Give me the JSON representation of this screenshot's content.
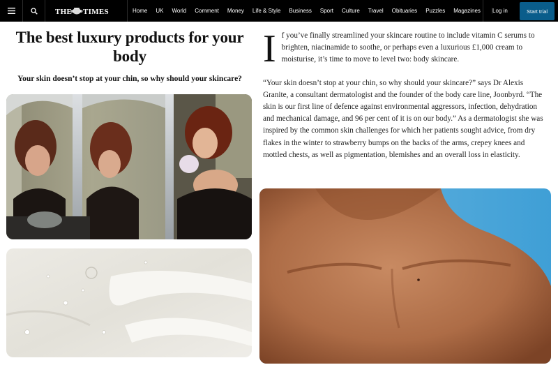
{
  "nav": {
    "menu_icon": "hamburger-menu-icon",
    "search_icon": "search-icon",
    "logo_text": "THE TIMES",
    "links": [
      "Home",
      "UK",
      "World",
      "Comment",
      "Money",
      "Life & Style",
      "Business",
      "Sport",
      "Culture",
      "Travel",
      "Obituaries",
      "Puzzles",
      "Magazines"
    ],
    "login": "Log in",
    "start_trial": "Start trial",
    "accent_color": "#0a5d8b"
  },
  "article": {
    "headline": "The best luxury products for your body",
    "standfirst": "Your skin doesn’t stop at your chin, so why should your skincare?",
    "dropcap": "I",
    "para1": "f you’ve finally streamlined your skincare routine to include vitamin C serums to brighten, niacinamide to soothe, or perhaps even a luxurious £1,000 cream to moisturise, it’s time to move to level two: body skincare.",
    "para2": "“Your skin doesn’t stop at your chin, so why should your skincare?” says Dr Alexis Granite, a consultant dermatologist and the founder of the body care line, Joonbyrd. “The skin is our first line of defence against environmental aggressors, infection, dehydration and mechanical damage, and 96 per cent of it is on our body.” As a dermatologist she was inspired by the common skin challenges for which her patients sought advice, from dry flakes in the winter to strawberry bumps on the backs of the arms, crepey knees and mottled chests, as well as pigmentation, blemishes and an overall loss in elasticity."
  }
}
